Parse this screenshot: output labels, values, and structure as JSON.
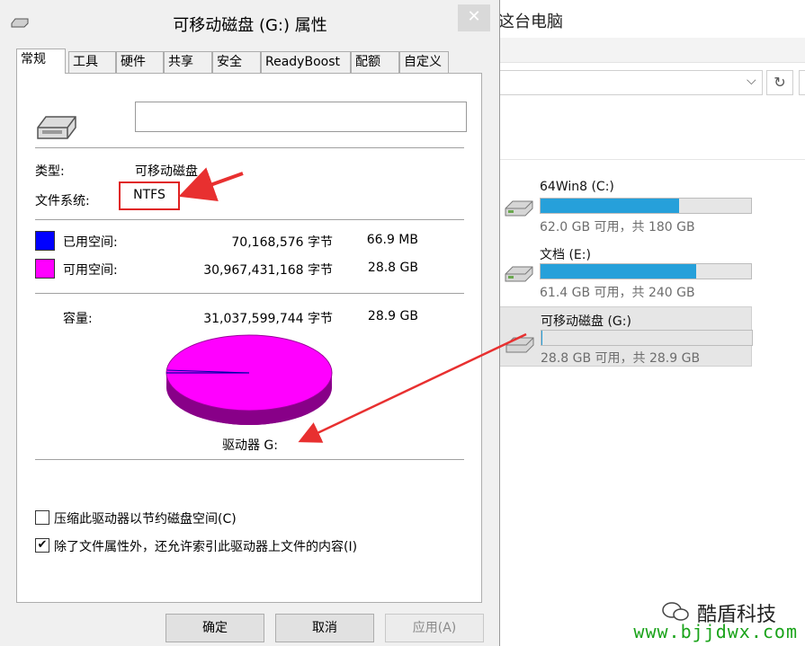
{
  "explorer": {
    "title": "这台电脑",
    "drives": [
      {
        "name": "64Win8 (C:)",
        "size_text": "62.0 GB 可用，共 180 GB",
        "used_fraction": 0.66
      },
      {
        "name": "文档 (E:)",
        "size_text": "61.4 GB 可用，共 240 GB",
        "used_fraction": 0.74
      },
      {
        "name": "可移动磁盘 (G:)",
        "size_text": "28.8 GB 可用，共 28.9 GB",
        "used_fraction": 0.002
      }
    ]
  },
  "dialog": {
    "title": "可移动磁盘 (G:) 属性",
    "close_label": "✕",
    "tabs": [
      "常规",
      "工具",
      "硬件",
      "共享",
      "安全",
      "ReadyBoost",
      "配额",
      "自定义"
    ],
    "active_tab": 0,
    "name_value": "",
    "type_label": "类型:",
    "type_value": "可移动磁盘",
    "fs_label": "文件系统:",
    "fs_value": "NTFS",
    "used_label": "已用空间:",
    "used_bytes": "70,168,576 字节",
    "used_size": "66.9 MB",
    "used_color": "#0000ff",
    "free_label": "可用空间:",
    "free_bytes": "30,967,431,168 字节",
    "free_size": "28.8 GB",
    "free_color": "#ff00ff",
    "cap_label": "容量:",
    "cap_bytes": "31,037,599,744 字节",
    "cap_size": "28.9 GB",
    "drive_label": "驱动器 G:",
    "compress_label": "压缩此驱动器以节约磁盘空间(C)",
    "compress_checked": false,
    "index_label": "除了文件属性外，还允许索引此驱动器上文件的内容(I)",
    "index_checked": true,
    "ok_label": "确定",
    "cancel_label": "取消",
    "apply_label": "应用(A)"
  },
  "watermark": {
    "brand": "酷盾科技",
    "url": "www.bjjdwx.com"
  }
}
